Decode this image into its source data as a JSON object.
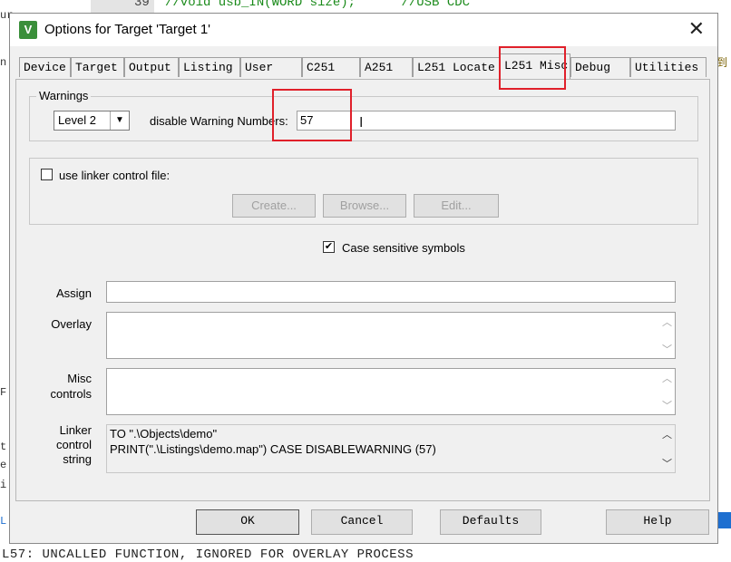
{
  "background": {
    "line_number": "39",
    "code_line": "//void usb_IN(WORD size);      //USB CDC",
    "left_fragments": [
      "ur",
      "n",
      "F",
      "t",
      "e",
      "i",
      "L"
    ],
    "bottom_message": "L57: UNCALLED FUNCTION, IGNORED FOR OVERLAY PROCESS",
    "right_fragment": "到"
  },
  "dialog": {
    "app_icon": "keil-uvision-icon",
    "app_icon_text": "V",
    "title": "Options for Target 'Target 1'",
    "close_glyph": "✕"
  },
  "tabs": [
    {
      "label": "Device",
      "active": false
    },
    {
      "label": "Target",
      "active": false
    },
    {
      "label": "Output",
      "active": false
    },
    {
      "label": "Listing",
      "active": false
    },
    {
      "label": "User",
      "active": false
    },
    {
      "label": "C251",
      "active": false
    },
    {
      "label": "A251",
      "active": false
    },
    {
      "label": "L251 Locate",
      "active": false
    },
    {
      "label": "L251 Misc",
      "active": true
    },
    {
      "label": "Debug",
      "active": false
    },
    {
      "label": "Utilities",
      "active": false
    }
  ],
  "warnings": {
    "legend": "Warnings",
    "level_value": "Level 2",
    "disable_label": "disable Warning Numbers:",
    "disable_value": "57"
  },
  "linker_control": {
    "checkbox_label": "use linker control file:",
    "checked": false,
    "create_label": "Create...",
    "browse_label": "Browse...",
    "edit_label": "Edit..."
  },
  "case_sensitive": {
    "label": "Case sensitive symbols",
    "checked": true,
    "check_glyph": "✔"
  },
  "fields": {
    "assign_label": "Assign",
    "assign_value": "",
    "overlay_label": "Overlay",
    "overlay_value": "",
    "misc_label_1": "Misc",
    "misc_label_2": "controls",
    "misc_value": "",
    "linker_string_label_1": "Linker",
    "linker_string_label_2": "control",
    "linker_string_label_3": "string",
    "linker_string_line_1": "TO \".\\Objects\\demo\"",
    "linker_string_line_2": "PRINT(\".\\Listings\\demo.map\") CASE DISABLEWARNING (57)"
  },
  "buttons": {
    "ok": "OK",
    "cancel": "Cancel",
    "defaults": "Defaults",
    "help": "Help"
  },
  "highlight_color": "#e0202a"
}
